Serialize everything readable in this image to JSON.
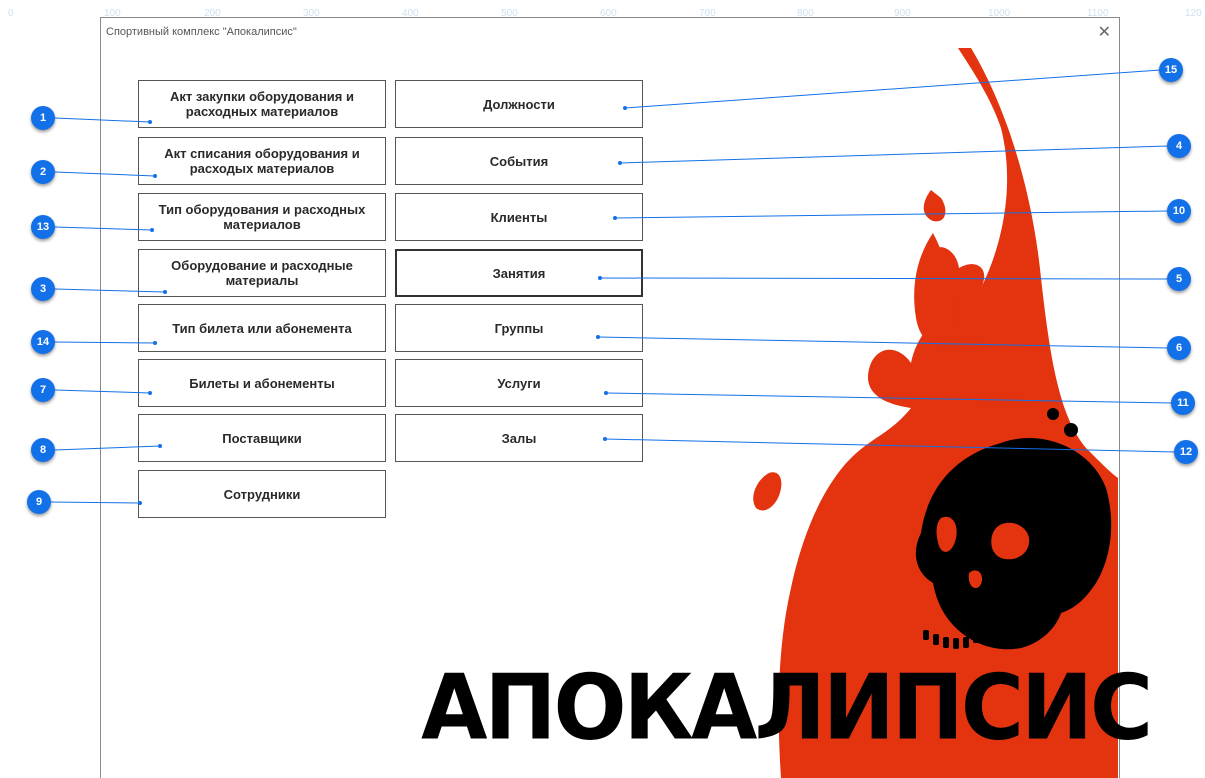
{
  "ruler": [
    "0",
    "100",
    "200",
    "300",
    "400",
    "500",
    "600",
    "700",
    "800",
    "900",
    "1000",
    "1100",
    "120"
  ],
  "window": {
    "title": "Спортивный комплекс \"Апокалипсис\"",
    "close_glyph": "✕"
  },
  "left_buttons": [
    "Акт закупки оборудования и расходных материалов",
    "Акт списания оборудования и расходых материалов",
    "Тип оборудования и расходных материалов",
    "Оборудование и расходные материалы",
    "Тип билета или абонемента",
    "Билеты и абонементы",
    "Поставщики",
    "Сотрудники"
  ],
  "right_buttons": [
    "Должности",
    "События",
    "Клиенты",
    "Занятия",
    "Группы",
    "Услуги",
    "Залы"
  ],
  "brand_text": "АПОКАЛИПСИС",
  "callouts": [
    "1",
    "2",
    "13",
    "3",
    "14",
    "7",
    "8",
    "9",
    "15",
    "4",
    "10",
    "5",
    "6",
    "11",
    "12"
  ],
  "colors": {
    "flame": "#e3330f",
    "callout": "#1271e8",
    "skull": "#000000"
  }
}
